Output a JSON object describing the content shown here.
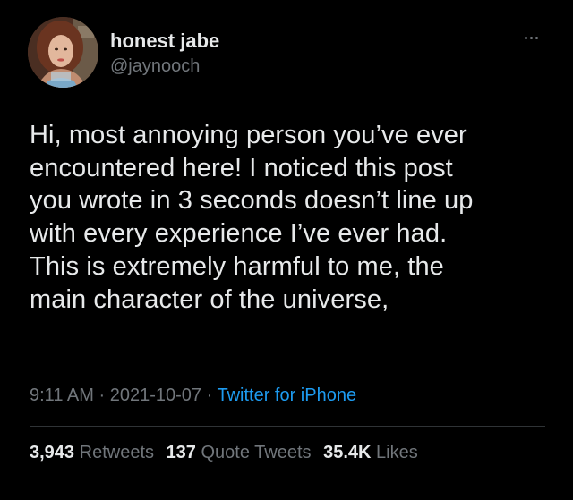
{
  "user": {
    "display_name": "honest jabe",
    "handle": "@jaynooch",
    "avatar_icon": "profile-photo"
  },
  "more_icon": "ellipsis-icon",
  "tweet": {
    "lines": [
      "Hi, most annoying person you’ve ever",
      "encountered here! I noticed this post",
      "you wrote in 3 seconds doesn’t line up",
      "with every experience I’ve ever had.",
      "This is extremely harmful to me, the",
      "main character of the universe,"
    ]
  },
  "meta": {
    "time": "9:11 AM",
    "separator": "·",
    "date": "2021-10-07",
    "source": "Twitter for iPhone"
  },
  "stats": {
    "retweets_count": "3,943",
    "retweets_label": "Retweets",
    "quotes_count": "137",
    "quotes_label": "Quote Tweets",
    "likes_count": "35.4K",
    "likes_label": "Likes"
  },
  "colors": {
    "background": "#000000",
    "primary_text": "#e7e9ea",
    "secondary_text": "#71767b",
    "link": "#1d9bf0",
    "divider": "#2f3336"
  }
}
